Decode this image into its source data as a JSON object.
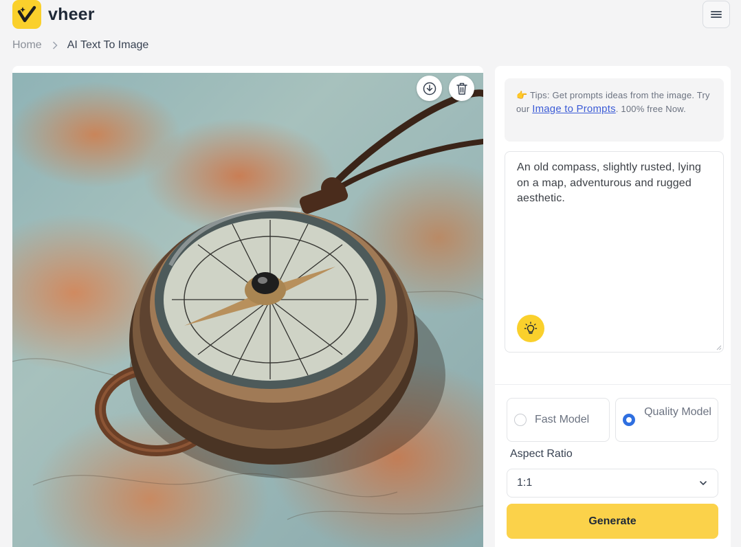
{
  "header": {
    "logo_text": "vheer",
    "menu_icon": "hamburger-menu-icon"
  },
  "breadcrumb": {
    "home": "Home",
    "current": "AI Text To Image"
  },
  "image_panel": {
    "download_icon": "download-icon",
    "delete_icon": "trash-icon"
  },
  "tips": {
    "emoji": "👉",
    "text_before": "Tips: Get prompts ideas from the image. Try our ",
    "link": "Image to Prompts",
    "text_after": ". 100% free Now."
  },
  "prompt": {
    "value": "An old compass, slightly rusted, lying on a map, adventurous and rugged aesthetic.",
    "bulb_icon": "lightbulb-icon"
  },
  "models": {
    "fast": "Fast Model",
    "quality": "Quality Model",
    "selected": "quality"
  },
  "aspect": {
    "label": "Aspect Ratio",
    "value": "1:1"
  },
  "generate": {
    "label": "Generate"
  },
  "colors": {
    "brand_yellow": "#fad02c",
    "link_blue": "#3b5bd6",
    "radio_blue": "#2f6fe0"
  }
}
